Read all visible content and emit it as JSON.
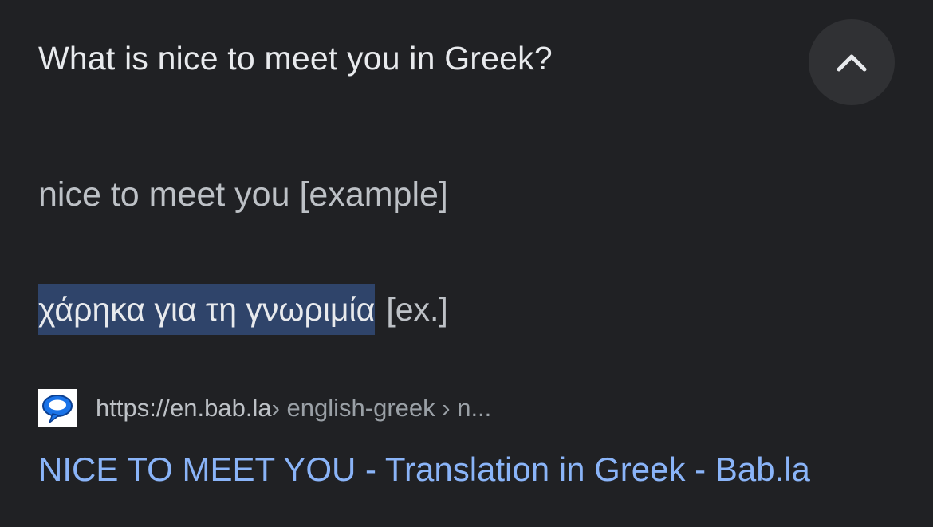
{
  "question": "What is nice to meet you in Greek?",
  "collapse_icon": "chevron-up-icon",
  "phrase": "nice to meet you [example]",
  "translation": {
    "text": "χάρηκα για τη γνωριμία",
    "tag": "[ex.]"
  },
  "source": {
    "favicon": "speech-bubble-icon",
    "host": "https://en.bab.la",
    "path": " › english-greek › n..."
  },
  "result_title": "NICE TO MEET YOU - Translation in Greek - Bab.la",
  "colors": {
    "background": "#202124",
    "highlight": "#2f446a",
    "link": "#8ab4f8",
    "favicon_blue": "#1a73e8"
  }
}
